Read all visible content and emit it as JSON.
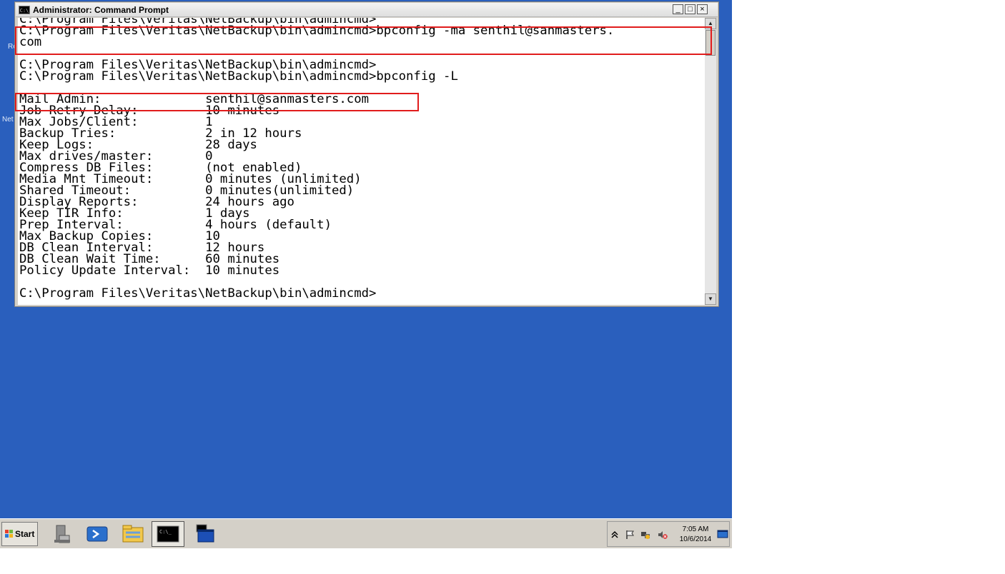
{
  "window": {
    "title": "Administrator: Command Prompt",
    "title_icon": "C:\\",
    "buttons": {
      "minimize": "_",
      "maximize": "□",
      "close": "×"
    }
  },
  "console": {
    "lines": [
      "C:\\Program Files\\Veritas\\NetBackup\\bin\\admincmd>",
      "C:\\Program Files\\Veritas\\NetBackup\\bin\\admincmd>bpconfig -ma senthil@sanmasters.",
      "com",
      "",
      "C:\\Program Files\\Veritas\\NetBackup\\bin\\admincmd>",
      "C:\\Program Files\\Veritas\\NetBackup\\bin\\admincmd>bpconfig -L",
      "",
      "Mail Admin:              senthil@sanmasters.com",
      "Job Retry Delay:         10 minutes",
      "Max Jobs/Client:         1",
      "Backup Tries:            2 in 12 hours",
      "Keep Logs:               28 days",
      "Max drives/master:       0",
      "Compress DB Files:       (not enabled)",
      "Media Mnt Timeout:       0 minutes (unlimited)",
      "Shared Timeout:          0 minutes(unlimited)",
      "Display Reports:         24 hours ago",
      "Keep TIR Info:           1 days",
      "Prep Interval:           4 hours (default)",
      "Max Backup Copies:       10",
      "DB Clean Interval:       12 hours",
      "DB Clean Wait Time:      60 minutes",
      "Policy Update Interval:  10 minutes",
      "",
      "C:\\Program Files\\Veritas\\NetBackup\\bin\\admincmd>"
    ]
  },
  "scrollbar": {
    "up_arrow": "▲",
    "down_arrow": "▼"
  },
  "desktop": {
    "labels": [
      "Re",
      "Net"
    ]
  },
  "taskbar": {
    "start_label": "Start",
    "items": [
      {
        "icon": "server-manager-icon"
      },
      {
        "icon": "powershell-icon"
      },
      {
        "icon": "explorer-folder-icon"
      },
      {
        "icon": "command-prompt-icon",
        "active": true
      },
      {
        "icon": "remote-desktop-icon"
      }
    ],
    "tray": {
      "icons": [
        "chevron-up-icon",
        "flag-icon",
        "network-icon",
        "speaker-muted-icon"
      ],
      "time": "7:05 AM",
      "date": "10/6/2014"
    }
  },
  "colors": {
    "desktop": "#2a5fbd",
    "highlight": "#e11c1c",
    "taskbar": "#d4d0c8"
  }
}
